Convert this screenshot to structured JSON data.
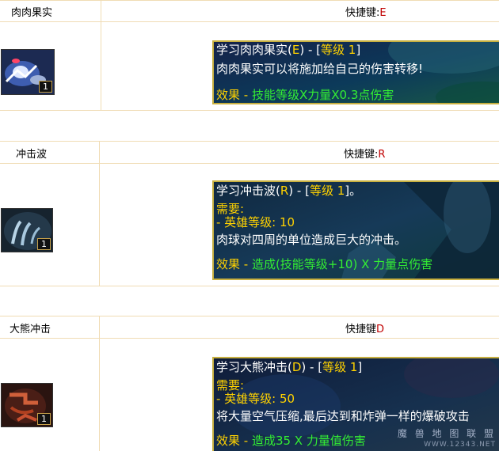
{
  "skills": [
    {
      "name": "肉肉果实",
      "hotkey_label": "快捷键:",
      "hotkey_key": "E",
      "icon": "meat-fruit-icon",
      "level": "1",
      "title_pre": "学习肉肉果实(",
      "title_key": "E",
      "title_mid": ") - [",
      "title_level": "等级 1",
      "title_post": "]",
      "desc": "肉肉果实可以将施加给自己的伤害转移!",
      "effect_label": "效果 - ",
      "effect_text": "技能等级X力量X0.3点伤害"
    },
    {
      "name": "冲击波",
      "hotkey_label": "快捷键:",
      "hotkey_key": "R",
      "icon": "shockwave-icon",
      "level": "1",
      "title_pre": "学习冲击波(",
      "title_key": "R",
      "title_mid": ") - [",
      "title_level": "等级 1",
      "title_post": "]。",
      "req_label": "需要:",
      "req_text": " - 英雄等级: 10",
      "desc": "肉球对四周的单位造成巨大的冲击。",
      "effect_label": "效果 - ",
      "effect_text": "造成(技能等级+10) X 力量点伤害"
    },
    {
      "name": "大熊冲击",
      "hotkey_label": "快捷键",
      "hotkey_key": "D",
      "icon": "bear-impact-icon",
      "level": "1",
      "title_pre": "学习大熊冲击(",
      "title_key": "D",
      "title_mid": ") - [",
      "title_level": "等级 1",
      "title_post": "]",
      "req_label": "需要:",
      "req_text": " - 英雄等级: 50",
      "desc": "将大量空气压缩,最后达到和炸弹一样的爆破攻击",
      "effect_label": "效果 - ",
      "effect_text": "造成35 X 力量值伤害"
    }
  ],
  "watermark": "魔 兽 地 图 联 盟",
  "watermark_url": "WWW.12343.NET",
  "colors": {
    "border": "#f0dcb4",
    "hotkey_key": "#c00000",
    "tooltip_yellow": "#ffd200",
    "tooltip_green": "#33ee33"
  }
}
